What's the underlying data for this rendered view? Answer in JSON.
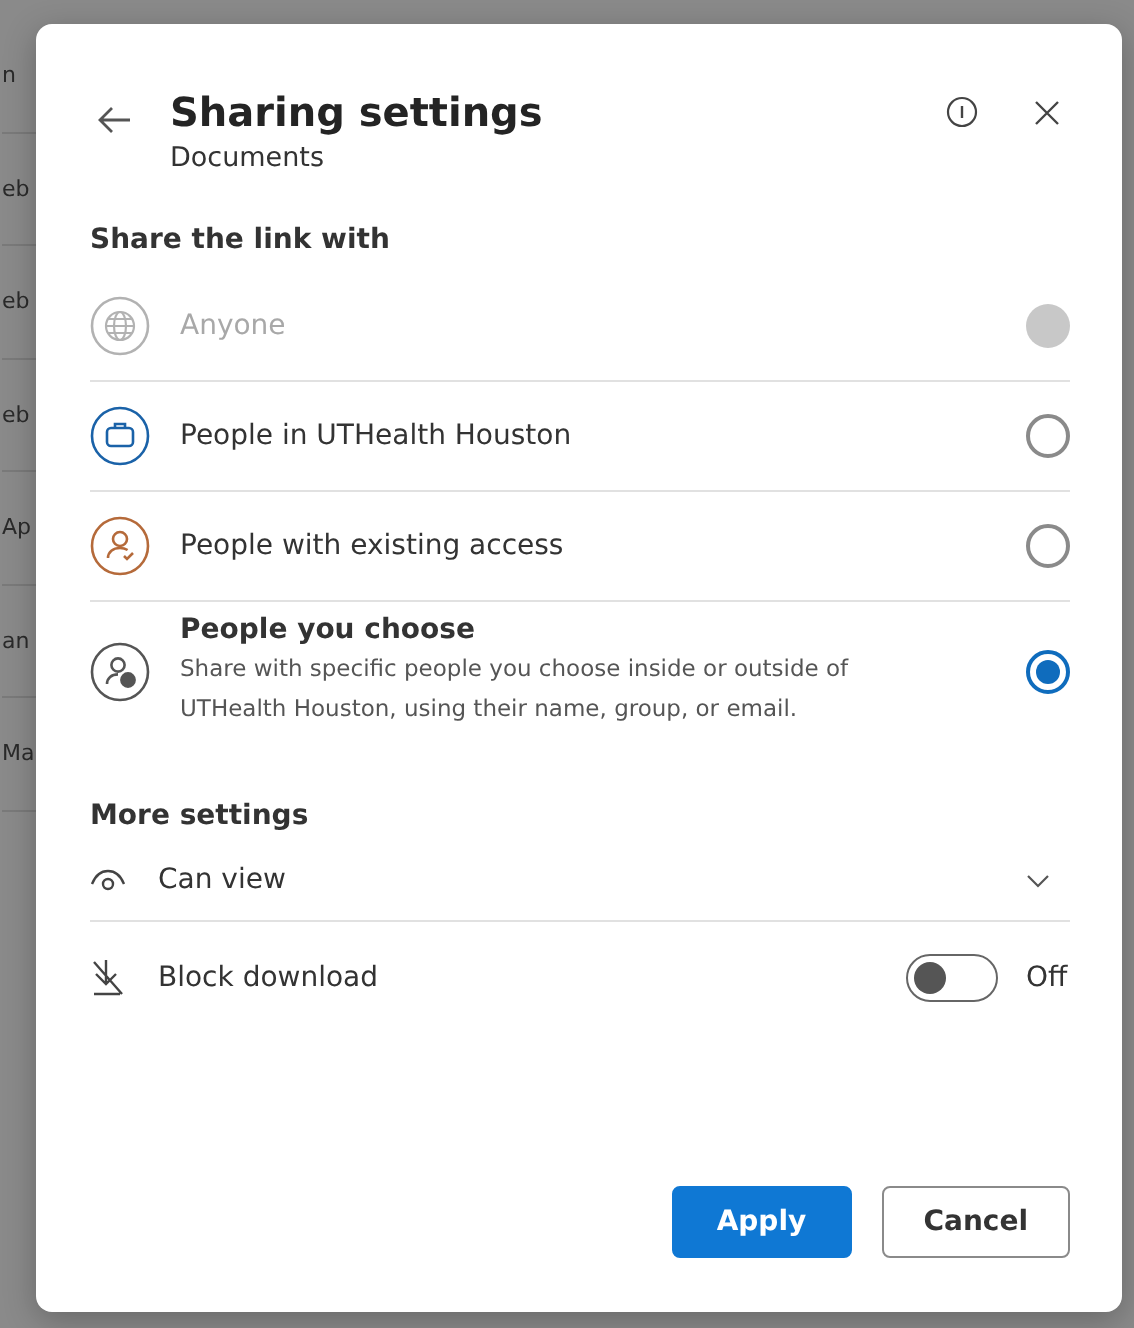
{
  "background_rows": [
    "n",
    "eb",
    "eb",
    "eb",
    "Ap",
    "an",
    "Ma"
  ],
  "dialog": {
    "title": "Sharing settings",
    "subtitle": "Documents"
  },
  "share_section": {
    "heading": "Share the link with",
    "options": [
      {
        "kind": "globe",
        "label": "Anyone",
        "disabled": true,
        "selected": false
      },
      {
        "kind": "briefcase",
        "label": "People in UTHealth Houston",
        "disabled": false,
        "selected": false
      },
      {
        "kind": "person",
        "label": "People with existing access",
        "disabled": false,
        "selected": false
      },
      {
        "kind": "people",
        "label": "People you choose",
        "description": "Share with specific people you choose inside or outside of UTHealth Houston, using their name, group, or email.",
        "disabled": false,
        "selected": true
      }
    ]
  },
  "more_settings": {
    "heading": "More settings",
    "permission": "Can view",
    "block_download": {
      "label": "Block download",
      "on": false,
      "state_text": "Off"
    }
  },
  "buttons": {
    "apply": "Apply",
    "cancel": "Cancel"
  }
}
